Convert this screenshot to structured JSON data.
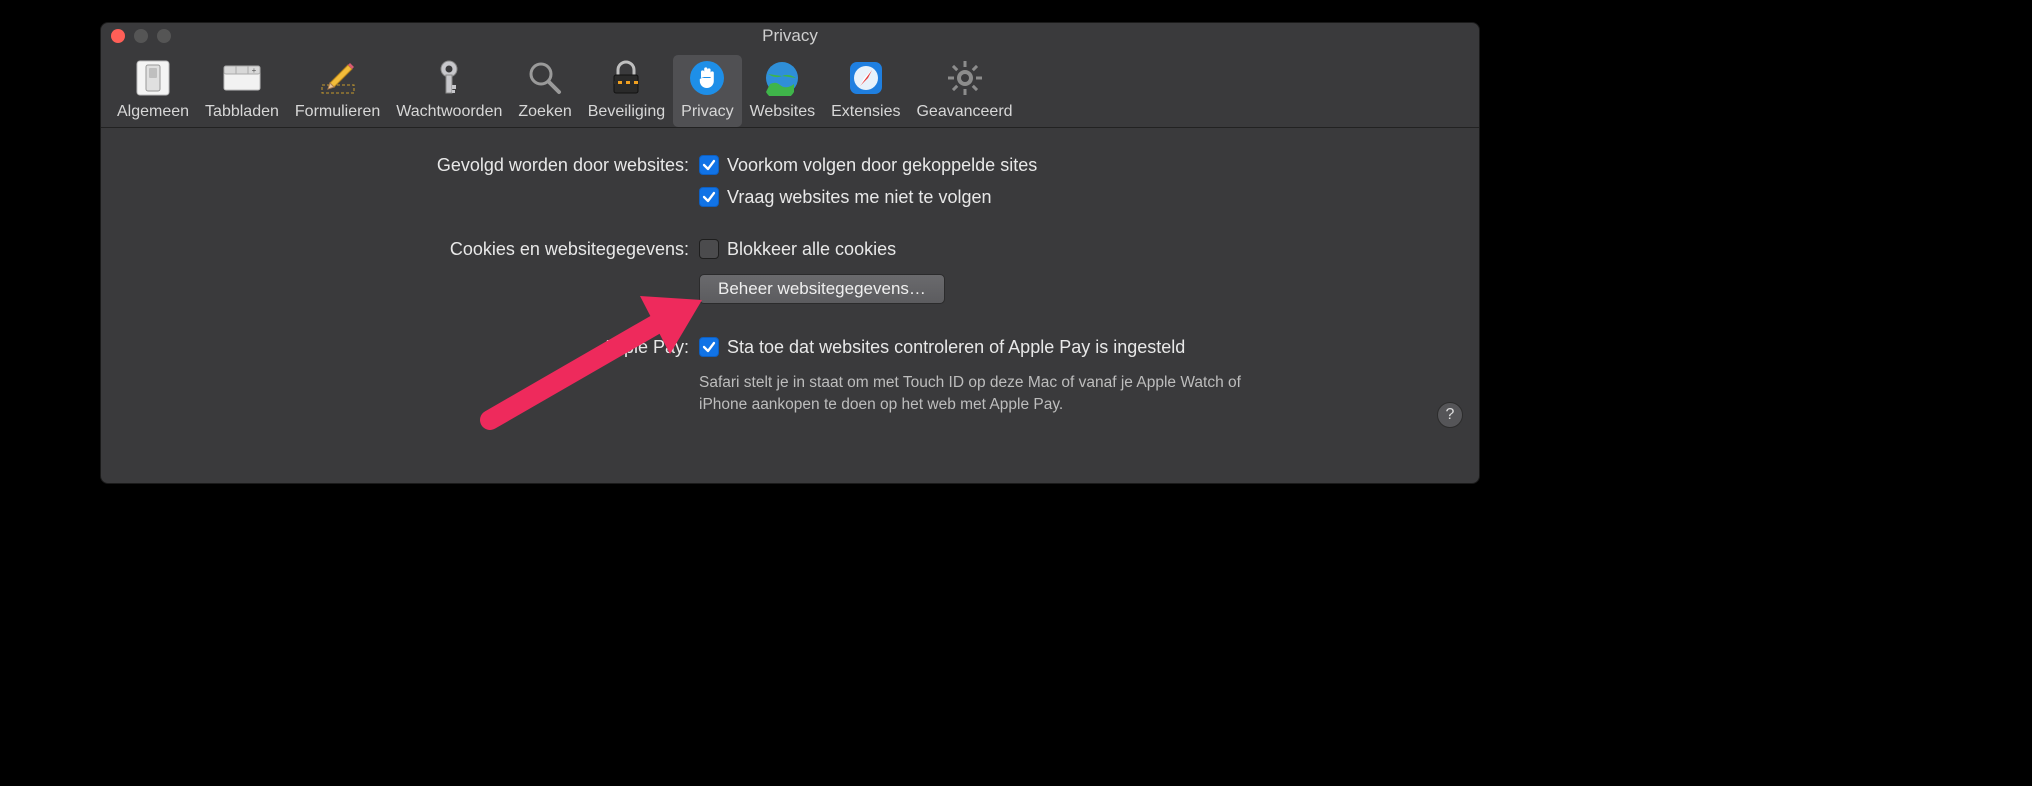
{
  "window": {
    "title": "Privacy"
  },
  "toolbar": [
    {
      "id": "general",
      "label": "Algemeen"
    },
    {
      "id": "tabs",
      "label": "Tabbladen"
    },
    {
      "id": "forms",
      "label": "Formulieren"
    },
    {
      "id": "passwords",
      "label": "Wachtwoorden"
    },
    {
      "id": "search",
      "label": "Zoeken"
    },
    {
      "id": "security",
      "label": "Beveiliging"
    },
    {
      "id": "privacy",
      "label": "Privacy",
      "selected": true
    },
    {
      "id": "websites",
      "label": "Websites"
    },
    {
      "id": "extensions",
      "label": "Extensies"
    },
    {
      "id": "advanced",
      "label": "Geavanceerd"
    }
  ],
  "sections": {
    "tracking": {
      "label": "Gevolgd worden door websites:",
      "opt1": {
        "label": "Voorkom volgen door gekoppelde sites",
        "checked": true
      },
      "opt2": {
        "label": "Vraag websites me niet te volgen",
        "checked": true
      }
    },
    "cookies": {
      "label": "Cookies en websitegegevens:",
      "opt1": {
        "label": "Blokkeer alle cookies",
        "checked": false
      },
      "button": "Beheer websitegegevens…"
    },
    "applepay": {
      "label": "Apple Pay:",
      "opt1": {
        "label": "Sta toe dat websites controleren of Apple Pay is ingesteld",
        "checked": true
      },
      "desc": "Safari stelt je in staat om met Touch ID op deze Mac of vanaf je Apple Watch of iPhone aankopen te doen op het web met Apple Pay."
    }
  },
  "help": "?",
  "colors": {
    "accent": "#1173e6",
    "arrow": "#ee2a5c"
  }
}
